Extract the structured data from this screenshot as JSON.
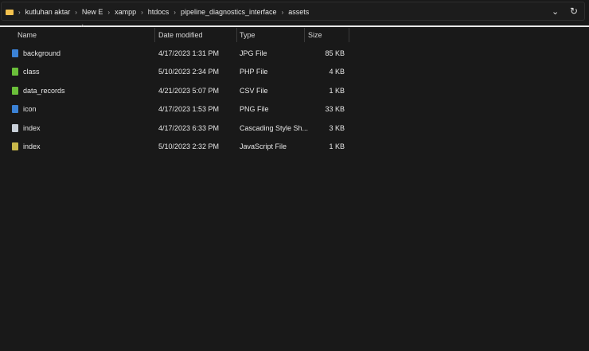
{
  "breadcrumb": [
    "kutluhan aktar",
    "New E",
    "xampp",
    "htdocs",
    "pipeline_diagnostics_interface",
    "assets"
  ],
  "address_bar": {
    "dropdown_icon": "chevron-down-icon",
    "refresh_icon": "refresh-icon"
  },
  "columns": {
    "name": "Name",
    "date": "Date modified",
    "type": "Type",
    "size": "Size"
  },
  "files": [
    {
      "name": "background",
      "date": "4/17/2023 1:31 PM",
      "type": "JPG File",
      "size": "85 KB",
      "icon_color": "#3b82d6"
    },
    {
      "name": "class",
      "date": "5/10/2023 2:34 PM",
      "type": "PHP File",
      "size": "4 KB",
      "icon_color": "#6bbf3a"
    },
    {
      "name": "data_records",
      "date": "4/21/2023 5:07 PM",
      "type": "CSV File",
      "size": "1 KB",
      "icon_color": "#6bbf3a"
    },
    {
      "name": "icon",
      "date": "4/17/2023 1:53 PM",
      "type": "PNG File",
      "size": "33 KB",
      "icon_color": "#3b82d6"
    },
    {
      "name": "index",
      "date": "4/17/2023 6:33 PM",
      "type": "Cascading Style Sh...",
      "size": "3 KB",
      "icon_color": "#c8cfd8"
    },
    {
      "name": "index",
      "date": "5/10/2023 2:32 PM",
      "type": "JavaScript File",
      "size": "1 KB",
      "icon_color": "#c9b84a"
    }
  ]
}
